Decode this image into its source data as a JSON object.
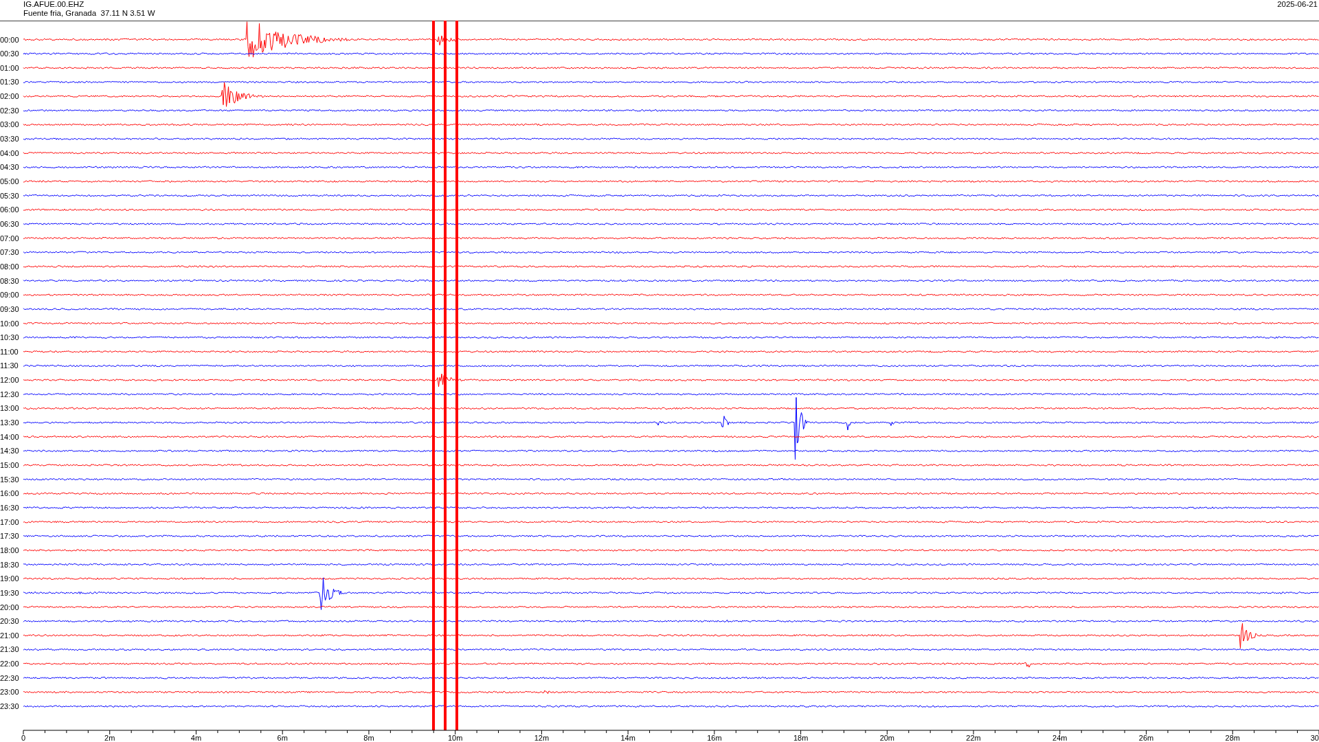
{
  "header": {
    "station": "IG.AFUE.00.EHZ",
    "location": "Fuente fria, Granada  37.11 N 3.51 W",
    "date": "2025-06-21"
  },
  "rows": [
    {
      "label": "00:00",
      "color": "#ff0000"
    },
    {
      "label": "00:30",
      "color": "#0000ff"
    },
    {
      "label": "01:00",
      "color": "#ff0000"
    },
    {
      "label": "01:30",
      "color": "#0000ff"
    },
    {
      "label": "02:00",
      "color": "#ff0000"
    },
    {
      "label": "02:30",
      "color": "#0000ff"
    },
    {
      "label": "03:00",
      "color": "#ff0000"
    },
    {
      "label": "03:30",
      "color": "#0000ff"
    },
    {
      "label": "04:00",
      "color": "#ff0000"
    },
    {
      "label": "04:30",
      "color": "#0000ff"
    },
    {
      "label": "05:00",
      "color": "#ff0000"
    },
    {
      "label": "05:30",
      "color": "#0000ff"
    },
    {
      "label": "06:00",
      "color": "#ff0000"
    },
    {
      "label": "06:30",
      "color": "#0000ff"
    },
    {
      "label": "07:00",
      "color": "#ff0000"
    },
    {
      "label": "07:30",
      "color": "#0000ff"
    },
    {
      "label": "08:00",
      "color": "#ff0000"
    },
    {
      "label": "08:30",
      "color": "#0000ff"
    },
    {
      "label": "09:00",
      "color": "#ff0000"
    },
    {
      "label": "09:30",
      "color": "#0000ff"
    },
    {
      "label": "10:00",
      "color": "#ff0000"
    },
    {
      "label": "10:30",
      "color": "#0000ff"
    },
    {
      "label": "11:00",
      "color": "#ff0000"
    },
    {
      "label": "11:30",
      "color": "#0000ff"
    },
    {
      "label": "12:00",
      "color": "#ff0000"
    },
    {
      "label": "12:30",
      "color": "#0000ff"
    },
    {
      "label": "13:00",
      "color": "#ff0000"
    },
    {
      "label": "13:30",
      "color": "#0000ff"
    },
    {
      "label": "14:00",
      "color": "#ff0000"
    },
    {
      "label": "14:30",
      "color": "#0000ff"
    },
    {
      "label": "15:00",
      "color": "#ff0000"
    },
    {
      "label": "15:30",
      "color": "#0000ff"
    },
    {
      "label": "16:00",
      "color": "#ff0000"
    },
    {
      "label": "16:30",
      "color": "#0000ff"
    },
    {
      "label": "17:00",
      "color": "#ff0000"
    },
    {
      "label": "17:30",
      "color": "#0000ff"
    },
    {
      "label": "18:00",
      "color": "#ff0000"
    },
    {
      "label": "18:30",
      "color": "#0000ff"
    },
    {
      "label": "19:00",
      "color": "#ff0000"
    },
    {
      "label": "19:30",
      "color": "#0000ff"
    },
    {
      "label": "20:00",
      "color": "#ff0000"
    },
    {
      "label": "20:30",
      "color": "#0000ff"
    },
    {
      "label": "21:00",
      "color": "#ff0000"
    },
    {
      "label": "21:30",
      "color": "#0000ff"
    },
    {
      "label": "22:00",
      "color": "#ff0000"
    },
    {
      "label": "22:30",
      "color": "#0000ff"
    },
    {
      "label": "23:00",
      "color": "#ff0000"
    },
    {
      "label": "23:30",
      "color": "#0000ff"
    }
  ],
  "x_axis": {
    "ticks": [
      "0",
      "2m",
      "4m",
      "6m",
      "8m",
      "10m",
      "12m",
      "14m",
      "16m",
      "18m",
      "20m",
      "22m",
      "24m",
      "26m",
      "28m",
      "30"
    ]
  }
}
